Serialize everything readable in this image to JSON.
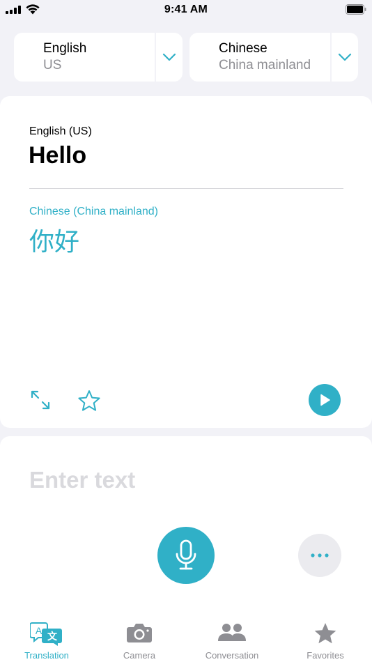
{
  "status_bar": {
    "time": "9:41 AM"
  },
  "languages": {
    "source": {
      "name": "English",
      "region": "US"
    },
    "target": {
      "name": "Chinese",
      "region": "China mainland"
    }
  },
  "result": {
    "source_label": "English (US)",
    "source_text": "Hello",
    "target_label": "Chinese (China mainland)",
    "target_text": "你好"
  },
  "input": {
    "placeholder": "Enter text"
  },
  "tabs": [
    {
      "label": "Translation",
      "icon": "translation-icon",
      "active": true
    },
    {
      "label": "Camera",
      "icon": "camera-icon",
      "active": false
    },
    {
      "label": "Conversation",
      "icon": "conversation-icon",
      "active": false
    },
    {
      "label": "Favorites",
      "icon": "favorites-star-icon",
      "active": false
    }
  ],
  "colors": {
    "accent": "#30b0c7",
    "inactive": "#8e8e93",
    "background": "#f2f2f7"
  }
}
